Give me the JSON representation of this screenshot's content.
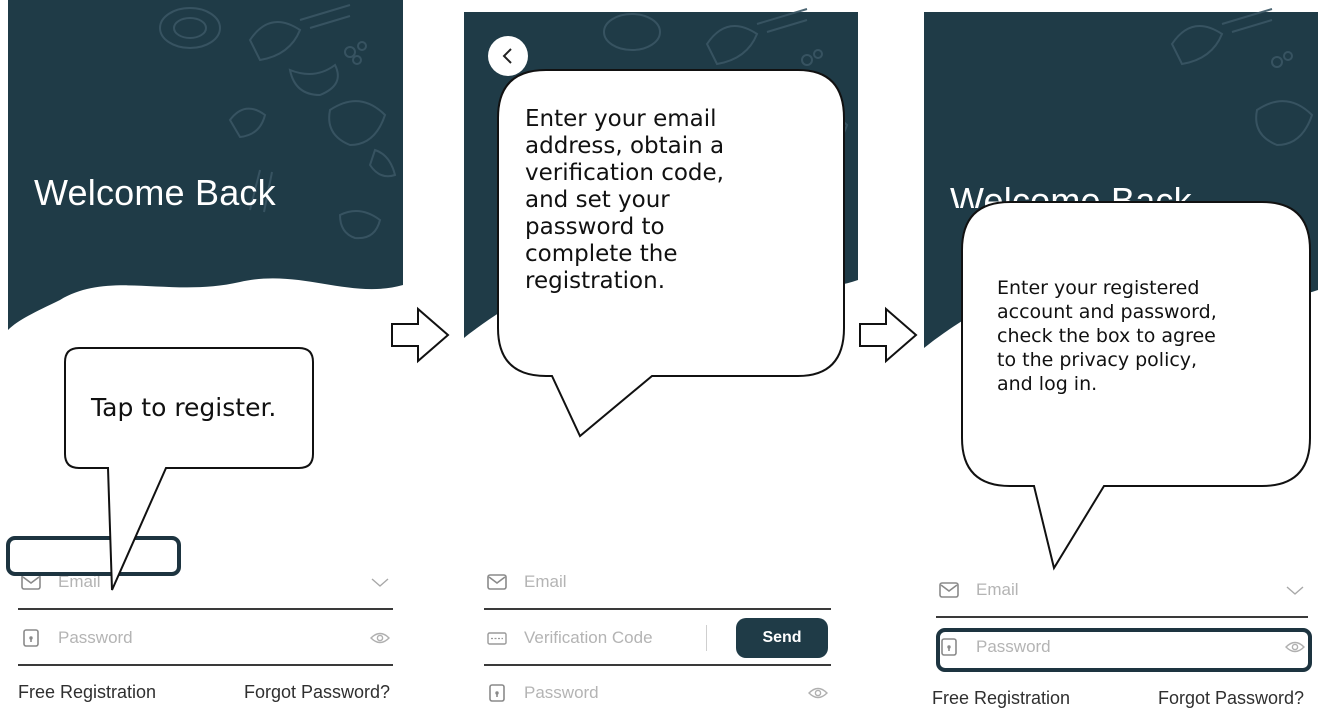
{
  "colors": {
    "hero_background": "#1f3b47",
    "highlight_border": "#1d3440",
    "send_button": "#1f3b47",
    "underline": "#3a3a3a",
    "placeholder": "#b4b4b4"
  },
  "panel_login": {
    "title": "Welcome Back",
    "email_placeholder": "Email",
    "password_placeholder": "Password",
    "free_registration_link": "Free Registration",
    "forgot_password_link": "Forgot Password?",
    "callout": "Tap to register."
  },
  "panel_register": {
    "email_placeholder": "Email",
    "verification_placeholder": "Verification Code",
    "send_button": "Send",
    "password_placeholder": "Password",
    "callout_lines": [
      "Enter your email",
      "address, obtain a",
      "verification code,",
      "and set your",
      "password to",
      "complete the",
      "registration."
    ]
  },
  "panel_login_2": {
    "title": "Welcome Back",
    "email_placeholder": "Email",
    "password_placeholder": "Password",
    "free_registration_link": "Free Registration",
    "forgot_password_link": "Forgot Password?",
    "callout_lines": [
      "Enter your registered",
      "account and password,",
      "check the box to agree",
      "to the privacy policy,",
      "and log in."
    ]
  },
  "icons": {
    "email": "envelope-icon",
    "password": "lock-icon",
    "verification": "verification-code-icon",
    "dropdown": "chevron-down-icon",
    "visibility": "eye-icon",
    "back": "chevron-left-icon",
    "flow": "right-arrow-icon"
  }
}
